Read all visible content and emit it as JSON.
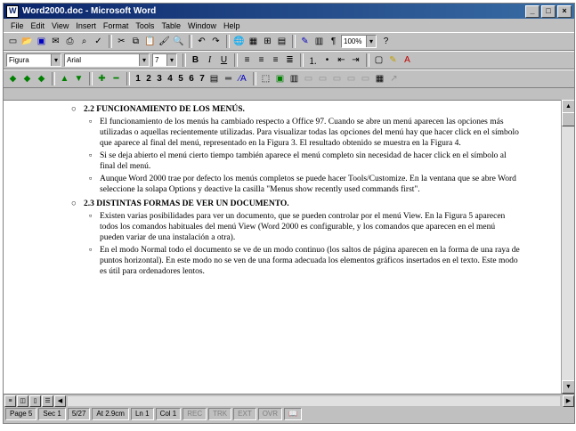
{
  "window": {
    "title": "Word2000.doc - Microsoft Word"
  },
  "menu": [
    "File",
    "Edit",
    "View",
    "Insert",
    "Format",
    "Tools",
    "Table",
    "Window",
    "Help"
  ],
  "format_bar": {
    "style": "Figura",
    "font": "Arial",
    "size": "7",
    "zoom": "100%"
  },
  "outline_numbers": [
    "1",
    "2",
    "3",
    "4",
    "5",
    "6",
    "7"
  ],
  "document": {
    "h1": {
      "num": "2.2",
      "title": "FUNCIONAMIENTO DE LOS MENÚS."
    },
    "h1_paras": [
      "El funcionamiento de los menús ha cambiado respecto a Office 97. Cuando se abre un menú aparecen las opciones más utilizadas o aquellas recientemente utilizadas. Para visualizar todas las opciones del menú hay que hacer click en el símbolo que aparece al final del menú, representado en la Figura 3. El resultado obtenido se muestra en la Figura 4.",
      "Si se deja abierto el menú cierto tiempo también aparece el menú completo sin necesidad de hacer click en el símbolo al final del menú.",
      "Aunque Word 2000 trae por defecto los menús completos se puede hacer Tools/Customize. En la ventana que se abre Word seleccione la solapa Options y deactive la casilla \"Menus show recently used commands first\"."
    ],
    "h2": {
      "num": "2.3",
      "title": "DISTINTAS FORMAS DE VER UN DOCUMENTO."
    },
    "h2_paras": [
      "Existen varias posibilidades para ver un documento, que se pueden controlar por el menú View. En la Figura 5 aparecen todos los comandos habituales del menú View (Word 2000 es configurable, y los comandos que aparecen en el menú pueden variar de una instalación a otra).",
      "En el modo Normal todo el documento se ve de un modo continuo (los saltos de página aparecen en la forma de una raya de puntos horizontal). En este modo no se ven de una forma adecuada los elementos gráficos insertados en el texto. Este modo es útil para ordenadores lentos."
    ]
  },
  "status": {
    "page": "Page 5",
    "sec": "Sec 1",
    "pos": "5/27",
    "at": "At 2.9cm",
    "ln": "Ln 1",
    "col": "Col 1",
    "modes": [
      "REC",
      "TRK",
      "EXT",
      "OVR"
    ]
  }
}
